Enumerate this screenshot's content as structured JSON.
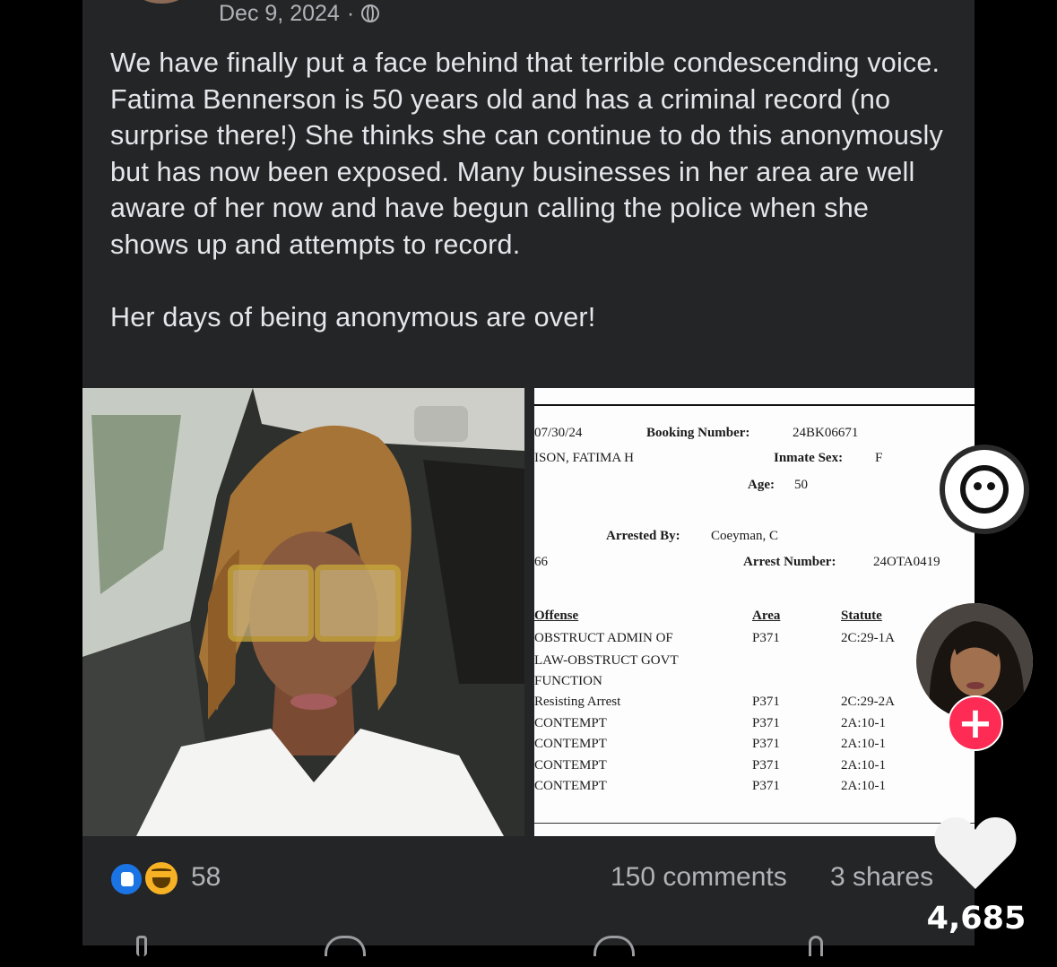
{
  "post": {
    "date": "Dec 9, 2024",
    "separator": "·",
    "audience_icon": "globe-icon",
    "body_paragraph_1": "We have finally put a face behind that terrible condescending voice.  Fatima Bennerson is 50 years old and has a criminal record (no surprise there!) She thinks she can continue to do this anonymously but has now been exposed. Many businesses in her area are well aware of her now and have begun calling the police when she shows up and attempts to record.",
    "body_paragraph_2": "Her days of being anonymous are over!",
    "reactions": {
      "icons": [
        "like-icon",
        "haha-icon"
      ],
      "count": "58"
    },
    "comments": "150 comments",
    "shares": "3 shares"
  },
  "booking_document": {
    "date": "07/30/24",
    "booking_number_label": "Booking Number:",
    "booking_number": "24BK06671",
    "name": "ISON, FATIMA H",
    "inmate_sex_label": "Inmate Sex:",
    "inmate_sex": "F",
    "age_label": "Age:",
    "age": "50",
    "arrested_by_label": "Arrested By:",
    "arrested_by": "Coeyman, C",
    "left_fragment": "66",
    "arrest_number_label": "Arrest Number:",
    "arrest_number": "24OTA0419",
    "columns": [
      "Offense",
      "Area",
      "Statute"
    ],
    "offenses": [
      {
        "offense": "OBSTRUCT ADMIN OF",
        "area": "P371",
        "statute": "2C:29-1A"
      },
      {
        "offense": "LAW-OBSTRUCT GOVT",
        "area": "",
        "statute": ""
      },
      {
        "offense": "FUNCTION",
        "area": "",
        "statute": ""
      },
      {
        "offense": "Resisting Arrest",
        "area": "P371",
        "statute": "2C:29-2A"
      },
      {
        "offense": "CONTEMPT",
        "area": "P371",
        "statute": "2A:10-1"
      },
      {
        "offense": "CONTEMPT",
        "area": "P371",
        "statute": "2A:10-1"
      },
      {
        "offense": "CONTEMPT",
        "area": "P371",
        "statute": "2A:10-1"
      },
      {
        "offense": "CONTEMPT",
        "area": "P371",
        "statute": "2A:10-1"
      }
    ]
  },
  "tiktok_rail": {
    "effect_icon": "face-icon",
    "follow_label": "+",
    "like_icon": "heart-icon",
    "like_count": "4,685"
  },
  "colors": {
    "post_background": "#242526",
    "post_text": "#e4e6eb",
    "meta_text": "#b0b3b8",
    "follow_accent": "#fe2c55"
  }
}
